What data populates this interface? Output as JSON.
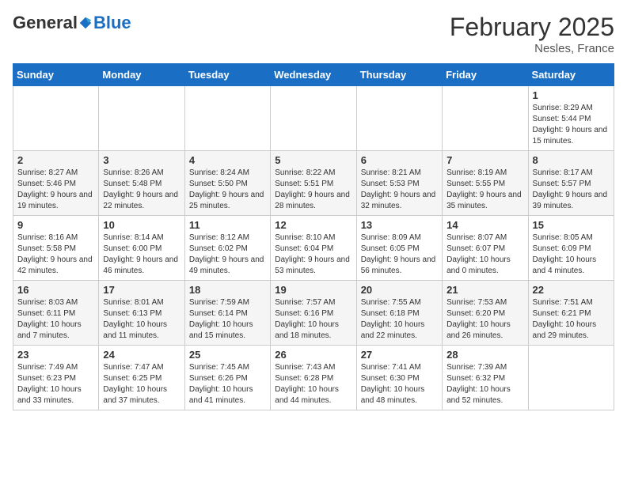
{
  "header": {
    "logo": {
      "general": "General",
      "blue": "Blue"
    },
    "title": "February 2025",
    "location": "Nesles, France"
  },
  "days_of_week": [
    "Sunday",
    "Monday",
    "Tuesday",
    "Wednesday",
    "Thursday",
    "Friday",
    "Saturday"
  ],
  "weeks": [
    [
      {
        "day": "",
        "content": ""
      },
      {
        "day": "",
        "content": ""
      },
      {
        "day": "",
        "content": ""
      },
      {
        "day": "",
        "content": ""
      },
      {
        "day": "",
        "content": ""
      },
      {
        "day": "",
        "content": ""
      },
      {
        "day": "1",
        "content": "Sunrise: 8:29 AM\nSunset: 5:44 PM\nDaylight: 9 hours and 15 minutes."
      }
    ],
    [
      {
        "day": "2",
        "content": "Sunrise: 8:27 AM\nSunset: 5:46 PM\nDaylight: 9 hours and 19 minutes."
      },
      {
        "day": "3",
        "content": "Sunrise: 8:26 AM\nSunset: 5:48 PM\nDaylight: 9 hours and 22 minutes."
      },
      {
        "day": "4",
        "content": "Sunrise: 8:24 AM\nSunset: 5:50 PM\nDaylight: 9 hours and 25 minutes."
      },
      {
        "day": "5",
        "content": "Sunrise: 8:22 AM\nSunset: 5:51 PM\nDaylight: 9 hours and 28 minutes."
      },
      {
        "day": "6",
        "content": "Sunrise: 8:21 AM\nSunset: 5:53 PM\nDaylight: 9 hours and 32 minutes."
      },
      {
        "day": "7",
        "content": "Sunrise: 8:19 AM\nSunset: 5:55 PM\nDaylight: 9 hours and 35 minutes."
      },
      {
        "day": "8",
        "content": "Sunrise: 8:17 AM\nSunset: 5:57 PM\nDaylight: 9 hours and 39 minutes."
      }
    ],
    [
      {
        "day": "9",
        "content": "Sunrise: 8:16 AM\nSunset: 5:58 PM\nDaylight: 9 hours and 42 minutes."
      },
      {
        "day": "10",
        "content": "Sunrise: 8:14 AM\nSunset: 6:00 PM\nDaylight: 9 hours and 46 minutes."
      },
      {
        "day": "11",
        "content": "Sunrise: 8:12 AM\nSunset: 6:02 PM\nDaylight: 9 hours and 49 minutes."
      },
      {
        "day": "12",
        "content": "Sunrise: 8:10 AM\nSunset: 6:04 PM\nDaylight: 9 hours and 53 minutes."
      },
      {
        "day": "13",
        "content": "Sunrise: 8:09 AM\nSunset: 6:05 PM\nDaylight: 9 hours and 56 minutes."
      },
      {
        "day": "14",
        "content": "Sunrise: 8:07 AM\nSunset: 6:07 PM\nDaylight: 10 hours and 0 minutes."
      },
      {
        "day": "15",
        "content": "Sunrise: 8:05 AM\nSunset: 6:09 PM\nDaylight: 10 hours and 4 minutes."
      }
    ],
    [
      {
        "day": "16",
        "content": "Sunrise: 8:03 AM\nSunset: 6:11 PM\nDaylight: 10 hours and 7 minutes."
      },
      {
        "day": "17",
        "content": "Sunrise: 8:01 AM\nSunset: 6:13 PM\nDaylight: 10 hours and 11 minutes."
      },
      {
        "day": "18",
        "content": "Sunrise: 7:59 AM\nSunset: 6:14 PM\nDaylight: 10 hours and 15 minutes."
      },
      {
        "day": "19",
        "content": "Sunrise: 7:57 AM\nSunset: 6:16 PM\nDaylight: 10 hours and 18 minutes."
      },
      {
        "day": "20",
        "content": "Sunrise: 7:55 AM\nSunset: 6:18 PM\nDaylight: 10 hours and 22 minutes."
      },
      {
        "day": "21",
        "content": "Sunrise: 7:53 AM\nSunset: 6:20 PM\nDaylight: 10 hours and 26 minutes."
      },
      {
        "day": "22",
        "content": "Sunrise: 7:51 AM\nSunset: 6:21 PM\nDaylight: 10 hours and 29 minutes."
      }
    ],
    [
      {
        "day": "23",
        "content": "Sunrise: 7:49 AM\nSunset: 6:23 PM\nDaylight: 10 hours and 33 minutes."
      },
      {
        "day": "24",
        "content": "Sunrise: 7:47 AM\nSunset: 6:25 PM\nDaylight: 10 hours and 37 minutes."
      },
      {
        "day": "25",
        "content": "Sunrise: 7:45 AM\nSunset: 6:26 PM\nDaylight: 10 hours and 41 minutes."
      },
      {
        "day": "26",
        "content": "Sunrise: 7:43 AM\nSunset: 6:28 PM\nDaylight: 10 hours and 44 minutes."
      },
      {
        "day": "27",
        "content": "Sunrise: 7:41 AM\nSunset: 6:30 PM\nDaylight: 10 hours and 48 minutes."
      },
      {
        "day": "28",
        "content": "Sunrise: 7:39 AM\nSunset: 6:32 PM\nDaylight: 10 hours and 52 minutes."
      },
      {
        "day": "",
        "content": ""
      }
    ]
  ]
}
